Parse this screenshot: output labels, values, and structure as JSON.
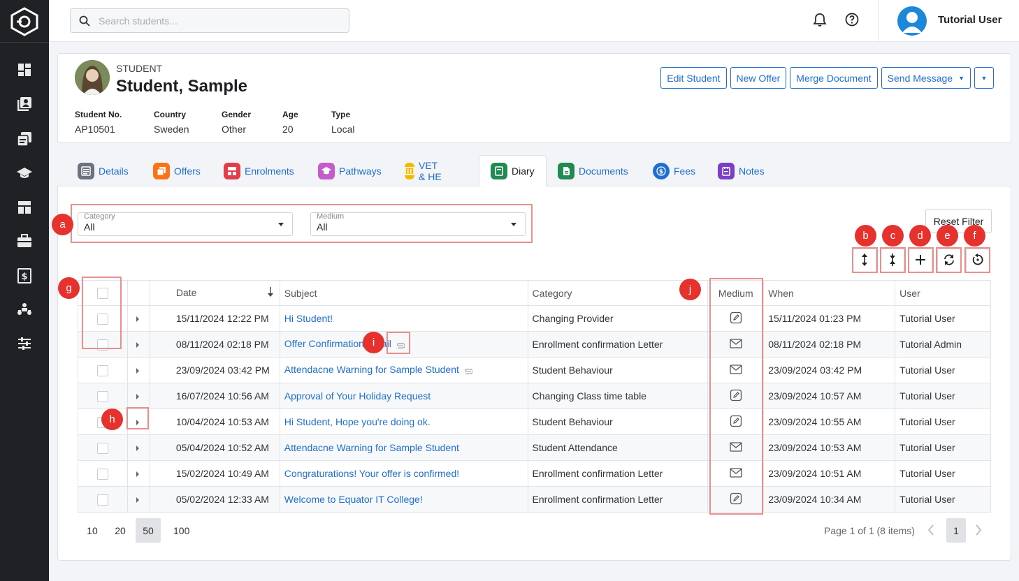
{
  "sidebar": {
    "logo": "app-logo",
    "items": [
      {
        "icon": "dashboard-icon"
      },
      {
        "icon": "students-icon"
      },
      {
        "icon": "documents-icon"
      },
      {
        "icon": "graduation-icon"
      },
      {
        "icon": "layout-icon"
      },
      {
        "icon": "briefcase-icon"
      },
      {
        "icon": "fees-icon"
      },
      {
        "icon": "network-icon"
      },
      {
        "icon": "settings-sliders-icon"
      }
    ]
  },
  "topbar": {
    "search_placeholder": "Search students...",
    "user_name": "Tutorial User"
  },
  "student": {
    "kind": "STUDENT",
    "name": "Student, Sample",
    "buttons": {
      "edit": "Edit Student",
      "new_offer": "New Offer",
      "merge": "Merge Document",
      "send": "Send Message"
    },
    "fields": [
      {
        "label": "Student No.",
        "value": "AP10501"
      },
      {
        "label": "Country",
        "value": "Sweden"
      },
      {
        "label": "Gender",
        "value": "Other"
      },
      {
        "label": "Age",
        "value": "20"
      },
      {
        "label": "Type",
        "value": "Local"
      }
    ]
  },
  "tabs": [
    {
      "label": "Details",
      "color": "#6b7280"
    },
    {
      "label": "Offers",
      "color": "#f97316"
    },
    {
      "label": "Enrolments",
      "color": "#e23d4b"
    },
    {
      "label": "Pathways",
      "color": "#c45dcc"
    },
    {
      "label": "VET & HE",
      "color": "#f5b800"
    },
    {
      "label": "Diary",
      "color": "#1f8a52",
      "active": true
    },
    {
      "label": "Documents",
      "color": "#1f8a52"
    },
    {
      "label": "Fees",
      "color": "#1f6fd1"
    },
    {
      "label": "Notes",
      "color": "#7a3fc9"
    }
  ],
  "filters": {
    "category": {
      "label": "Category",
      "value": "All"
    },
    "medium": {
      "label": "Medium",
      "value": "All"
    },
    "reset": "Reset Filter"
  },
  "annotations": [
    "a",
    "b",
    "c",
    "d",
    "e",
    "f",
    "g",
    "h",
    "i",
    "j"
  ],
  "grid": {
    "columns": {
      "date": "Date",
      "subject": "Subject",
      "category": "Category",
      "medium": "Medium",
      "when": "When",
      "user": "User"
    },
    "rows": [
      {
        "date": "15/11/2024 12:22 PM",
        "subject": "Hi Student!",
        "attachment": false,
        "category": "Changing Provider",
        "medium": "note",
        "when": "15/11/2024 01:23 PM",
        "user": "Tutorial User"
      },
      {
        "date": "08/11/2024 02:18 PM",
        "subject": "Offer Confirmation Email",
        "attachment": true,
        "category": "Enrollment confirmation Letter",
        "medium": "email",
        "when": "08/11/2024 02:18 PM",
        "user": "Tutorial Admin"
      },
      {
        "date": "23/09/2024 03:42 PM",
        "subject": "Attendacne Warning for Sample Student",
        "attachment": true,
        "category": "Student Behaviour",
        "medium": "email",
        "when": "23/09/2024 03:42 PM",
        "user": "Tutorial User"
      },
      {
        "date": "16/07/2024 10:56 AM",
        "subject": "Approval of Your Holiday Request",
        "attachment": false,
        "category": "Changing Class time table",
        "medium": "note",
        "when": "23/09/2024 10:57 AM",
        "user": "Tutorial User"
      },
      {
        "date": "10/04/2024 10:53 AM",
        "subject": "Hi Student, Hope you're doing ok.",
        "attachment": false,
        "category": "Student Behaviour",
        "medium": "note",
        "when": "23/09/2024 10:55 AM",
        "user": "Tutorial User"
      },
      {
        "date": "05/04/2024 10:52 AM",
        "subject": "Attendacne Warning for Sample Student",
        "attachment": false,
        "category": "Student Attendance",
        "medium": "email",
        "when": "23/09/2024 10:53 AM",
        "user": "Tutorial User"
      },
      {
        "date": "15/02/2024 10:49 AM",
        "subject": "Congraturations! Your offer is confirmed!",
        "attachment": false,
        "category": "Enrollment confirmation Letter",
        "medium": "email",
        "when": "23/09/2024 10:51 AM",
        "user": "Tutorial User"
      },
      {
        "date": "05/02/2024 12:33 AM",
        "subject": "Welcome to Equator IT College!",
        "attachment": false,
        "category": "Enrollment confirmation Letter",
        "medium": "note",
        "when": "23/09/2024 10:34 AM",
        "user": "Tutorial User"
      }
    ]
  },
  "pager": {
    "sizes": [
      "10",
      "20",
      "50",
      "100"
    ],
    "selected_size": "50",
    "info": "Page 1 of 1 (8 items)",
    "current_page": "1"
  }
}
